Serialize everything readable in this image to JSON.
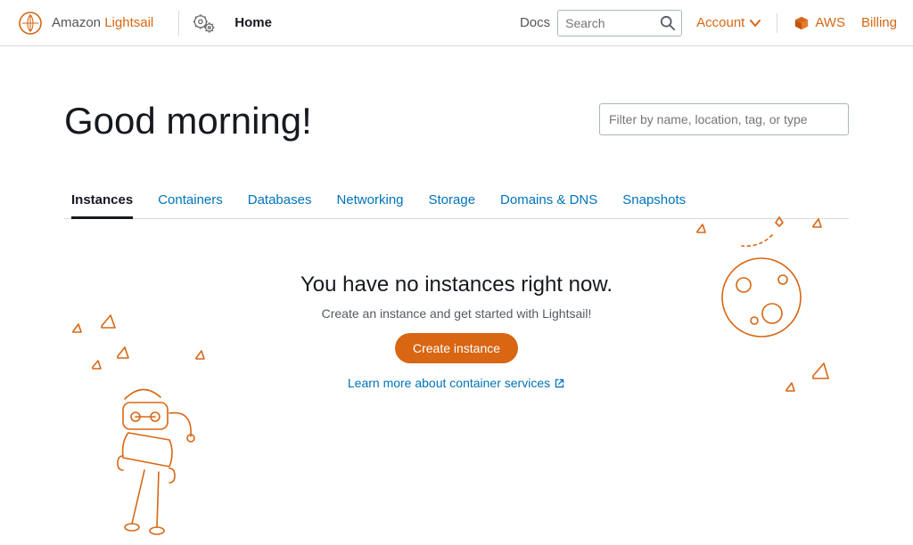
{
  "brand": {
    "first": "Amazon",
    "second": "Lightsail"
  },
  "nav": {
    "home_label": "Home",
    "docs_label": "Docs",
    "search_placeholder": "Search",
    "account_label": "Account",
    "aws_label": "AWS",
    "billing_label": "Billing"
  },
  "main": {
    "greeting": "Good morning!",
    "filter_placeholder": "Filter by name, location, tag, or type"
  },
  "tabs": [
    {
      "label": "Instances",
      "active": true
    },
    {
      "label": "Containers",
      "active": false
    },
    {
      "label": "Databases",
      "active": false
    },
    {
      "label": "Networking",
      "active": false
    },
    {
      "label": "Storage",
      "active": false
    },
    {
      "label": "Domains & DNS",
      "active": false
    },
    {
      "label": "Snapshots",
      "active": false
    }
  ],
  "empty": {
    "heading": "You have no instances right now.",
    "sub": "Create an instance and get started with Lightsail!",
    "cta": "Create instance",
    "learn": "Learn more about container services"
  },
  "colors": {
    "accent": "#d86613",
    "link": "#0073bb"
  }
}
